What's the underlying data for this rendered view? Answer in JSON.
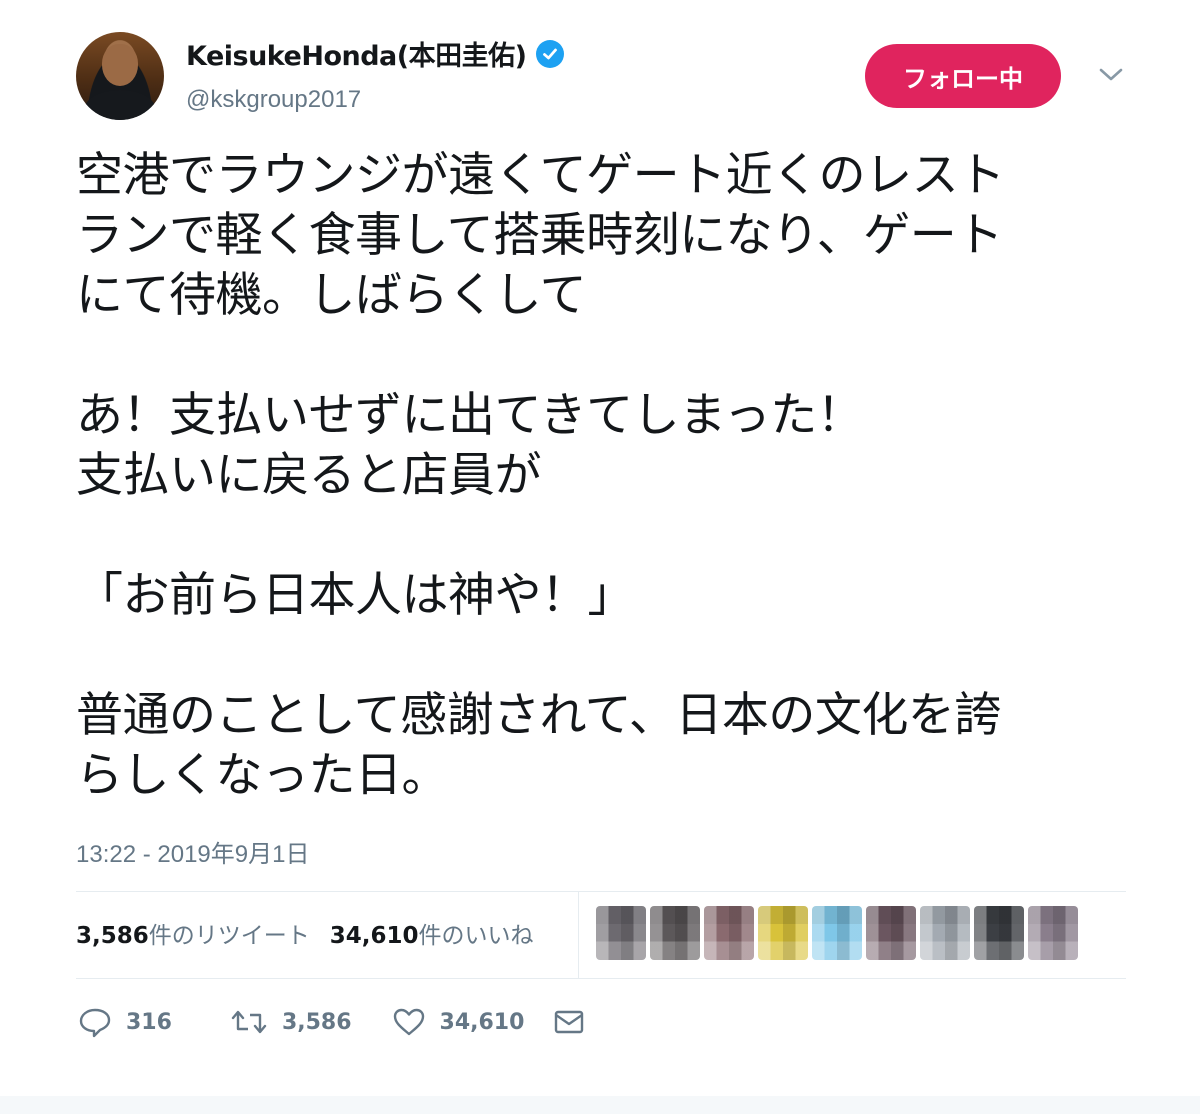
{
  "author": {
    "display_name": "KeisukeHonda(本田圭佑)",
    "handle": "@kskgroup2017",
    "verified": true,
    "avatar_icon": "profile-photo"
  },
  "follow_button": {
    "label": "フォロー中",
    "color": "#e0245e"
  },
  "menu_icon": "chevron-down-icon",
  "tweet": {
    "lines": [
      "空港でラウンジが遠くてゲート近くのレスト",
      "ランで軽く食事して搭乗時刻になり、ゲート",
      "にて待機。しばらくして",
      "",
      "あ！支払いせずに出てきてしまった！",
      "支払いに戻ると店員が",
      "",
      "「お前ら日本人は神や！」",
      "",
      "普通のことして感謝されて、日本の文化を誇",
      "らしくなった日。"
    ],
    "timestamp": "13:22 - 2019年9月1日"
  },
  "stats": {
    "retweets_num": "3,586",
    "retweets_label": "件のリツイート",
    "likes_num": "34,610",
    "likes_label": "件のいいね"
  },
  "likers": [
    {
      "icon": "user-avatar-blurred",
      "color": "#6d6a70"
    },
    {
      "icon": "user-avatar-blurred",
      "color": "#5c585a"
    },
    {
      "icon": "user-avatar-blurred",
      "color": "#8a6a6f"
    },
    {
      "icon": "user-avatar-blurred",
      "color": "#d8c23a"
    },
    {
      "icon": "user-avatar-blurred",
      "color": "#7fc7e8"
    },
    {
      "icon": "user-avatar-blurred",
      "color": "#6b5660"
    },
    {
      "icon": "user-avatar-blurred",
      "color": "#a3aab2"
    },
    {
      "icon": "user-avatar-blurred",
      "color": "#3c3f44"
    },
    {
      "icon": "user-avatar-blurred",
      "color": "#8a7e8c"
    }
  ],
  "actions": {
    "reply_count": "316",
    "retweet_count": "3,586",
    "like_count": "34,610"
  },
  "colors": {
    "text": "#14171a",
    "secondary": "#657786",
    "verified_blue": "#1da1f2",
    "divider": "#e6ecf0"
  }
}
